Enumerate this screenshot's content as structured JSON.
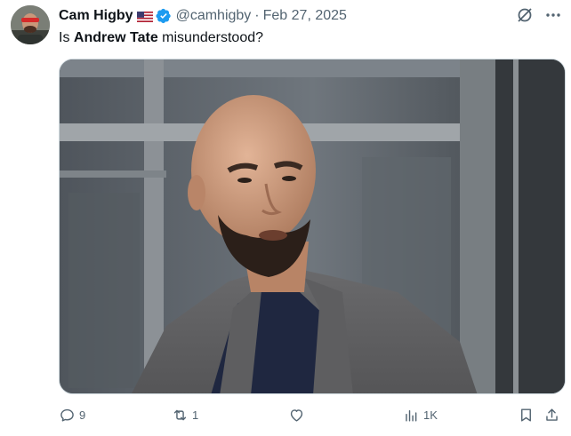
{
  "tweet": {
    "author_name": "Cam Higby",
    "handle": "@camhigby",
    "separator": "·",
    "date": "Feb 27, 2025",
    "text_before": "Is ",
    "text_bold": "Andrew Tate",
    "text_after": " misunderstood?",
    "accent_color": "#1d9bf0"
  },
  "actions": {
    "replies": "9",
    "reposts": "1",
    "views": "1K"
  }
}
